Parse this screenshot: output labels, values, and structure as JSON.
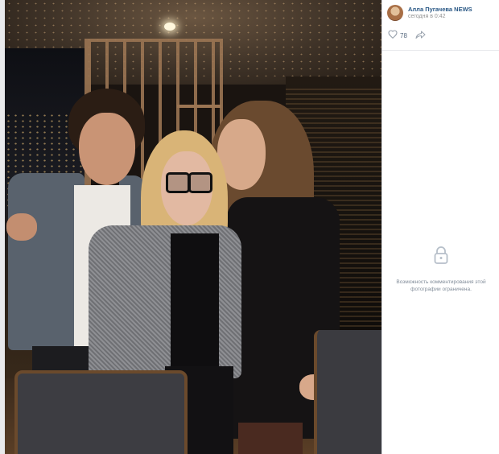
{
  "post": {
    "author_name": "Алла Пугачева NEWS",
    "time": "сегодня в 0:42",
    "likes": "78"
  },
  "comments": {
    "closed_line1": "Возможность комментирования этой",
    "closed_line2": "фотографии ограничена."
  },
  "icons": {
    "like": "heart-icon",
    "share": "share-arrow-icon",
    "lock": "lock-icon"
  },
  "colors": {
    "author_link": "#2a5885",
    "muted_text": "#939393",
    "icon_gray": "#99a2ad"
  }
}
